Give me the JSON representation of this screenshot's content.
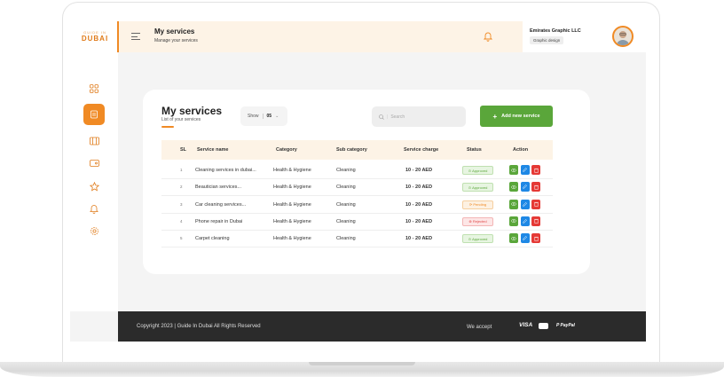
{
  "logo": {
    "line1": "GUIDE IN",
    "line2": "DUBAI"
  },
  "header": {
    "title": "My services",
    "subtitle": "Manage your services"
  },
  "user": {
    "name": "Emirates Graphic LLC",
    "role": "Graphic design"
  },
  "card": {
    "title": "My services",
    "subtitle": "List of your services",
    "show_label": "Show",
    "show_value": "05",
    "search_placeholder": "Search",
    "add_button": "Add new service"
  },
  "table": {
    "headers": [
      "SL",
      "Service name",
      "Category",
      "Sub category",
      "Service charge",
      "Status",
      "Action"
    ],
    "rows": [
      {
        "sl": "1",
        "name": "Cleaning services in dubai...",
        "category": "Health & Hygiene",
        "sub": "Cleaning",
        "charge": "10 - 20 AED",
        "status": "Approved"
      },
      {
        "sl": "2",
        "name": "Beautician services...",
        "category": "Health & Hygiene",
        "sub": "Cleaning",
        "charge": "10 - 20 AED",
        "status": "Approved"
      },
      {
        "sl": "3",
        "name": "Car cleaning services...",
        "category": "Health & Hygiene",
        "sub": "Cleaning",
        "charge": "10 - 20 AED",
        "status": "Pending"
      },
      {
        "sl": "4",
        "name": "Phone repair in Dubai",
        "category": "Health & Hygiene",
        "sub": "Cleaning",
        "charge": "10 - 20 AED",
        "status": "Rejected"
      },
      {
        "sl": "5",
        "name": "Carpet cleaning",
        "category": "Health & Hygiene",
        "sub": "Cleaning",
        "charge": "10 - 20 AED",
        "status": "Approved"
      }
    ]
  },
  "footer": {
    "copyright": "Copyright 2023 | Guide In Dubai All Rights Reserved",
    "accept_label": "We accept",
    "payments": [
      "VISA",
      "PayPal"
    ]
  },
  "colors": {
    "accent": "#f08a24",
    "green": "#5aa63a",
    "dark": "#2b2b2b"
  },
  "sidebar_icons": [
    "grid-icon",
    "services-icon",
    "wallet-icon",
    "card-icon",
    "star-icon",
    "bell-icon",
    "settings-icon"
  ]
}
